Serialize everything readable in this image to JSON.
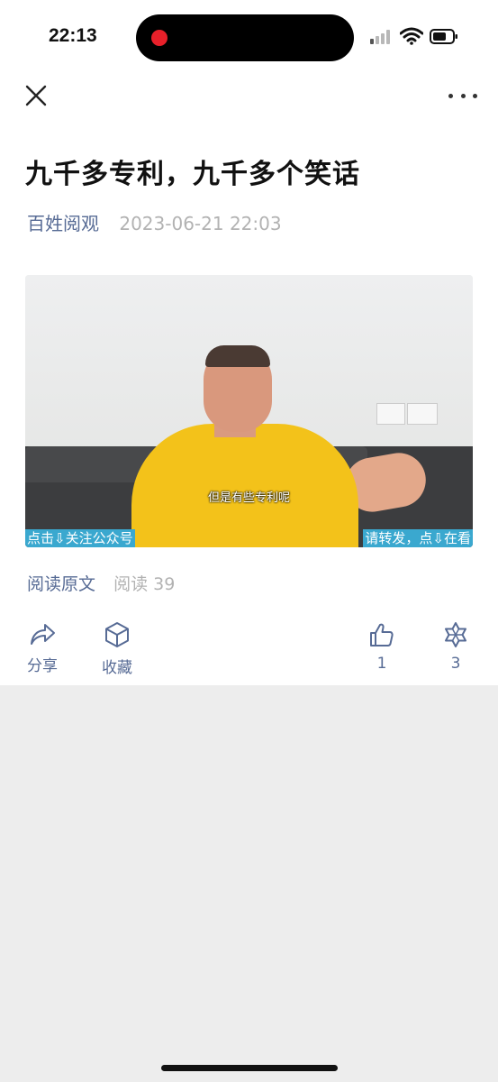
{
  "status_bar": {
    "time": "22:13"
  },
  "article": {
    "title": "九千多专利，九千多个笑话",
    "author": "百姓阅观",
    "date": "2023-06-21 22:03"
  },
  "video": {
    "subtitle": "但是有些专利呢",
    "banner_left": "点击⇩关注公众号",
    "banner_right": "请转发，点⇩在看"
  },
  "read_row": {
    "read_original": "阅读原文",
    "read_count": "阅读 39"
  },
  "actions": {
    "share_label": "分享",
    "favorite_label": "收藏",
    "like_count": "1",
    "wow_count": "3"
  },
  "colors": {
    "link": "#576b95",
    "muted": "#b2b2b2",
    "background": "#ededed"
  }
}
